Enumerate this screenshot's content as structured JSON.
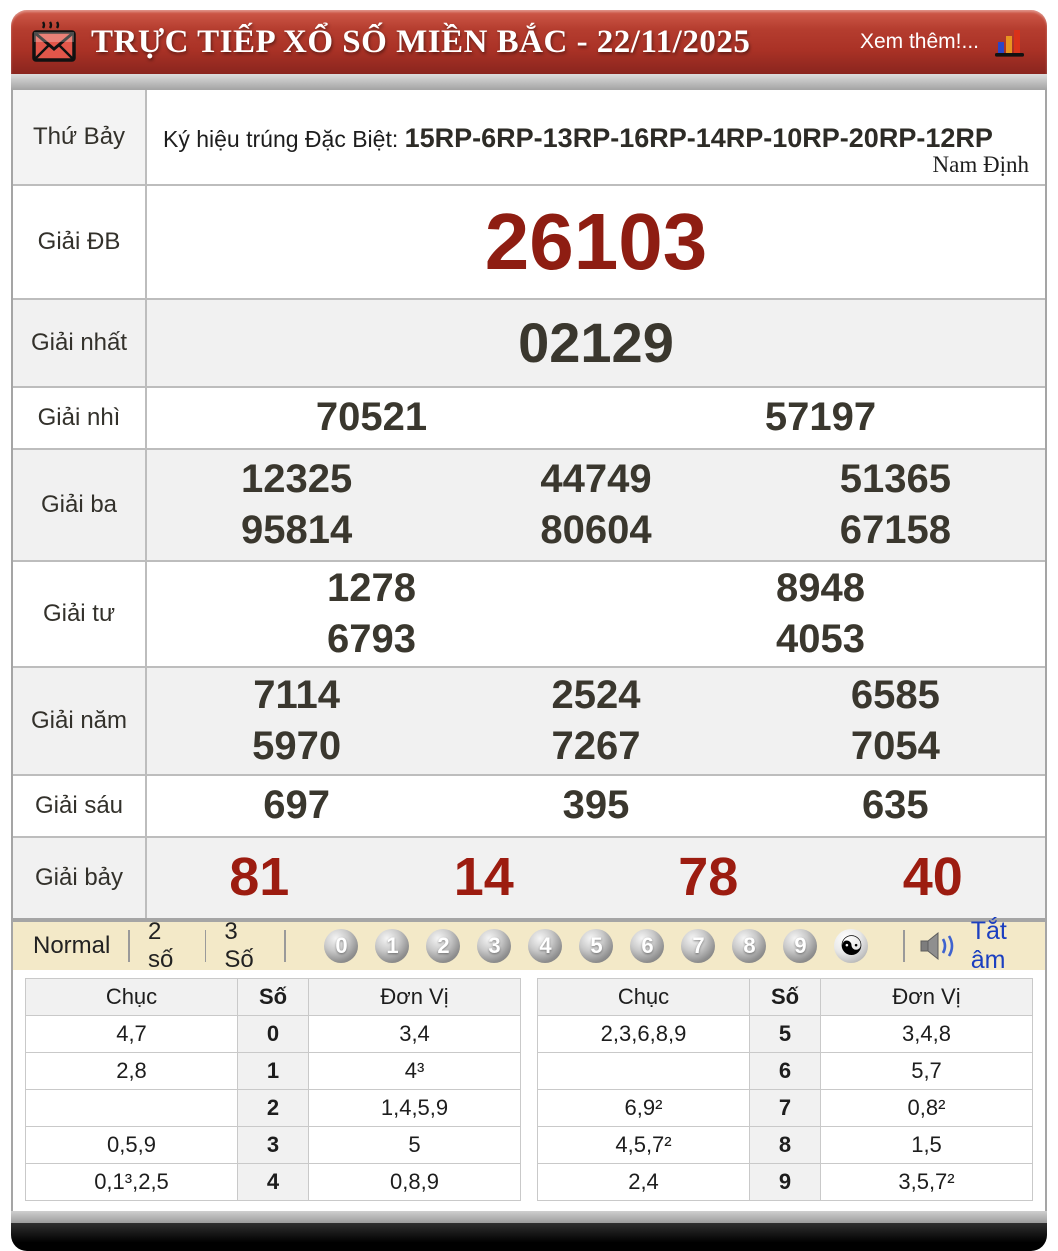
{
  "colors": {
    "header_red": "#aa3226",
    "special_red": "#8e1d12",
    "seven_red": "#9c1c10",
    "cream": "#f3e9c8",
    "link_blue": "#1b3fc0",
    "dark_number": "#3a372e"
  },
  "header": {
    "title": "TRỰC TIẾP XỔ SỐ MIỀN BẮC - 22/11/2025",
    "more": "Xem thêm!..."
  },
  "info": {
    "day": "Thứ Bảy",
    "prefix": "Ký hiệu trúng Đặc Biệt: ",
    "code": "15RP-6RP-13RP-16RP-14RP-10RP-20RP-12RP",
    "province": "Nam Định"
  },
  "prizes": [
    {
      "label": "Giải ĐB",
      "rows": [
        [
          "26103"
        ]
      ]
    },
    {
      "label": "Giải nhất",
      "rows": [
        [
          "02129"
        ]
      ]
    },
    {
      "label": "Giải nhì",
      "rows": [
        [
          "70521",
          "57197"
        ]
      ]
    },
    {
      "label": "Giải ba",
      "rows": [
        [
          "12325",
          "44749",
          "51365"
        ],
        [
          "95814",
          "80604",
          "67158"
        ]
      ]
    },
    {
      "label": "Giải tư",
      "rows": [
        [
          "1278",
          "8948"
        ],
        [
          "6793",
          "4053"
        ]
      ]
    },
    {
      "label": "Giải năm",
      "rows": [
        [
          "7114",
          "2524",
          "6585"
        ],
        [
          "5970",
          "7267",
          "7054"
        ]
      ]
    },
    {
      "label": "Giải sáu",
      "rows": [
        [
          "697",
          "395",
          "635"
        ]
      ]
    },
    {
      "label": "Giải bảy",
      "rows": [
        [
          "81",
          "14",
          "78",
          "40"
        ]
      ]
    }
  ],
  "controls": {
    "modes": [
      "Normal",
      "2 số",
      "3 Số"
    ],
    "balls": [
      "0",
      "1",
      "2",
      "3",
      "4",
      "5",
      "6",
      "7",
      "8",
      "9"
    ],
    "yinyang": "☯",
    "mute": "Tắt âm"
  },
  "stats": {
    "headers": {
      "chuc": "Chục",
      "so": "Số",
      "donvi": "Đơn Vị"
    },
    "left": [
      {
        "chuc": "4,7",
        "so": "0",
        "donvi": "3,4"
      },
      {
        "chuc": "2,8",
        "so": "1",
        "donvi": "4³"
      },
      {
        "chuc": "",
        "so": "2",
        "donvi": "1,4,5,9"
      },
      {
        "chuc": "0,5,9",
        "so": "3",
        "donvi": "5"
      },
      {
        "chuc": "0,1³,2,5",
        "so": "4",
        "donvi": "0,8,9"
      }
    ],
    "right": [
      {
        "chuc": "2,3,6,8,9",
        "so": "5",
        "donvi": "3,4,8"
      },
      {
        "chuc": "",
        "so": "6",
        "donvi": "5,7"
      },
      {
        "chuc": "6,9²",
        "so": "7",
        "donvi": "0,8²"
      },
      {
        "chuc": "4,5,7²",
        "so": "8",
        "donvi": "1,5"
      },
      {
        "chuc": "2,4",
        "so": "9",
        "donvi": "3,5,7²"
      }
    ]
  }
}
